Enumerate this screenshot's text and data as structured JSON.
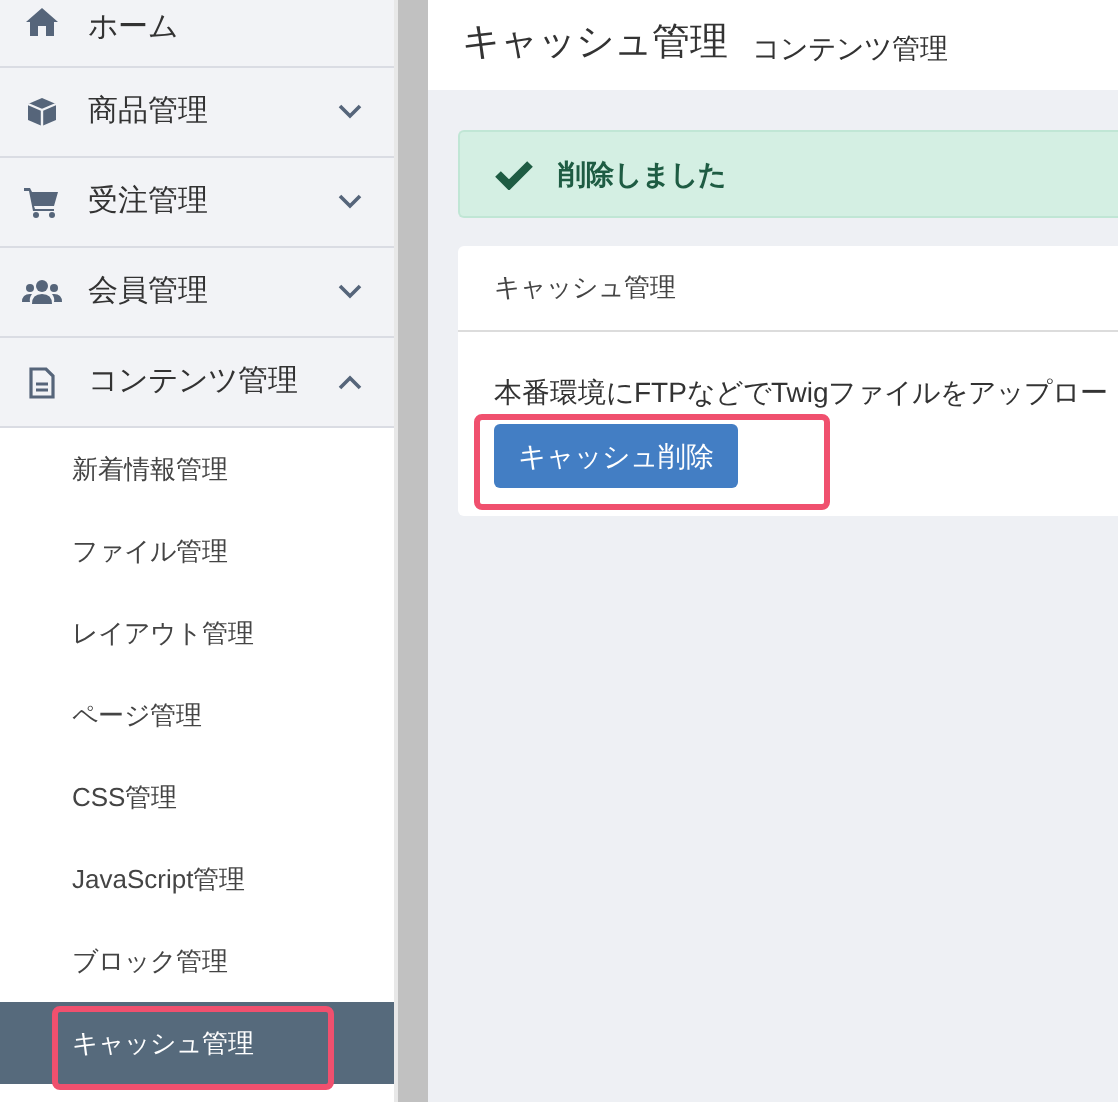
{
  "sidebar": {
    "items": [
      {
        "label": "ホーム",
        "kind": "link"
      },
      {
        "label": "商品管理",
        "kind": "group",
        "expanded": false
      },
      {
        "label": "受注管理",
        "kind": "group",
        "expanded": false
      },
      {
        "label": "会員管理",
        "kind": "group",
        "expanded": false
      },
      {
        "label": "コンテンツ管理",
        "kind": "group",
        "expanded": true,
        "children": [
          {
            "label": "新着情報管理",
            "selected": false,
            "highlighted": false
          },
          {
            "label": "ファイル管理",
            "selected": false,
            "highlighted": false
          },
          {
            "label": "レイアウト管理",
            "selected": false,
            "highlighted": false
          },
          {
            "label": "ページ管理",
            "selected": false,
            "highlighted": false
          },
          {
            "label": "CSS管理",
            "selected": false,
            "highlighted": false
          },
          {
            "label": "JavaScript管理",
            "selected": false,
            "highlighted": false
          },
          {
            "label": "ブロック管理",
            "selected": false,
            "highlighted": false
          },
          {
            "label": "キャッシュ管理",
            "selected": true,
            "highlighted": true
          }
        ]
      }
    ]
  },
  "header": {
    "title": "キャッシュ管理",
    "subtitle": "コンテンツ管理"
  },
  "alert": {
    "message": "削除しました"
  },
  "card": {
    "title": "キャッシュ管理",
    "text": "本番環境にFTPなどでTwigファイルをアップロー",
    "button": {
      "label": "キャッシュ削除",
      "highlighted": true
    }
  }
}
